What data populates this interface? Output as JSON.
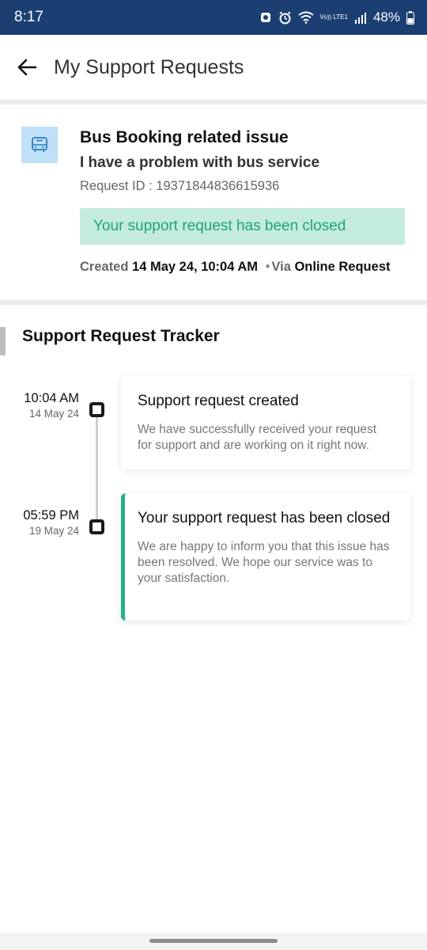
{
  "status_bar": {
    "time": "8:17",
    "lte_label": "Vo)) LTE1",
    "battery_percent": "48%"
  },
  "header": {
    "title": "My Support Requests"
  },
  "request": {
    "category": "Bus Booking related issue",
    "subject": "I have a problem with bus service",
    "request_id": "Request ID : 19371844836615936",
    "status_text": "Your support request has been closed",
    "created_label": "Created",
    "created_at": "14 May 24, 10:04 AM",
    "via_label": "Via",
    "via_value": "Online Request"
  },
  "tracker": {
    "title": "Support Request Tracker",
    "events": [
      {
        "time": "10:04 AM",
        "date": "14 May 24",
        "title": "Support request created",
        "description": "We have successfully received your request for support and are working on it right now."
      },
      {
        "time": "05:59 PM",
        "date": "19 May 24",
        "title": "Your support request has been closed",
        "description": "We are happy to inform you that this issue has been resolved. We hope our service was to your satisfaction."
      }
    ]
  },
  "colors": {
    "status_bar": "#1c3f73",
    "closed_banner_bg": "#c3ecdd",
    "closed_banner_text": "#23a181",
    "bus_icon_bg": "#bfe0f7",
    "closed_accent": "#23b08f"
  }
}
